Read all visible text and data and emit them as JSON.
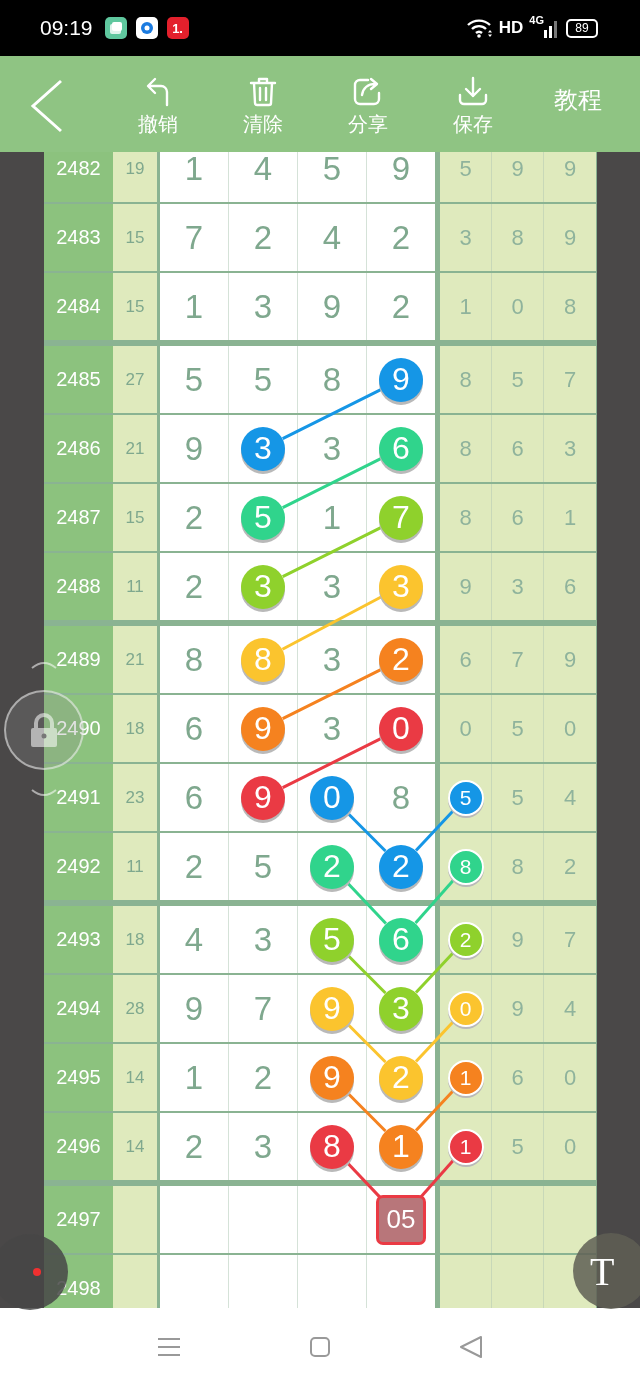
{
  "status_bar": {
    "time": "09:19",
    "app_badge": "1.",
    "network": "HD",
    "cellular": "4G",
    "battery": "89"
  },
  "toolbar": {
    "items": [
      {
        "label": "撤销",
        "kind": "undo"
      },
      {
        "label": "清除",
        "kind": "clear"
      },
      {
        "label": "分享",
        "kind": "share"
      },
      {
        "label": "保存",
        "kind": "save"
      }
    ],
    "tutorial": "教程"
  },
  "chart": {
    "groups": [
      {
        "rows": [
          {
            "period": "2482",
            "sum": "19",
            "cells": [
              {
                "kind": "digit",
                "text": "1"
              },
              {
                "kind": "digit",
                "text": "4"
              },
              {
                "kind": "digit",
                "text": "5"
              },
              {
                "kind": "digit",
                "text": "9"
              },
              {
                "kind": "digit",
                "text": "5"
              },
              {
                "kind": "digit",
                "text": "9"
              },
              {
                "kind": "digit",
                "text": "9"
              }
            ]
          },
          {
            "period": "2483",
            "sum": "15",
            "cells": [
              {
                "kind": "digit",
                "text": "7"
              },
              {
                "kind": "digit",
                "text": "2"
              },
              {
                "kind": "digit",
                "text": "4"
              },
              {
                "kind": "digit",
                "text": "2"
              },
              {
                "kind": "digit",
                "text": "3"
              },
              {
                "kind": "digit",
                "text": "8"
              },
              {
                "kind": "digit",
                "text": "9"
              }
            ]
          },
          {
            "period": "2484",
            "sum": "15",
            "cells": [
              {
                "kind": "digit",
                "text": "1"
              },
              {
                "kind": "digit",
                "text": "3"
              },
              {
                "kind": "digit",
                "text": "9"
              },
              {
                "kind": "digit",
                "text": "2"
              },
              {
                "kind": "digit",
                "text": "1"
              },
              {
                "kind": "digit",
                "text": "0"
              },
              {
                "kind": "digit",
                "text": "8"
              }
            ]
          }
        ]
      },
      {
        "rows": [
          {
            "period": "2485",
            "sum": "27",
            "cells": [
              {
                "kind": "digit",
                "text": "5"
              },
              {
                "kind": "digit",
                "text": "5"
              },
              {
                "kind": "digit",
                "text": "8"
              },
              {
                "kind": "ball",
                "text": "9",
                "color": "#1596e6"
              },
              {
                "kind": "digit",
                "text": "8"
              },
              {
                "kind": "digit",
                "text": "5"
              },
              {
                "kind": "digit",
                "text": "7"
              }
            ]
          },
          {
            "period": "2486",
            "sum": "21",
            "cells": [
              {
                "kind": "digit",
                "text": "9"
              },
              {
                "kind": "ball",
                "text": "3",
                "color": "#1596e6"
              },
              {
                "kind": "digit",
                "text": "3"
              },
              {
                "kind": "ball",
                "text": "6",
                "color": "#30d48c"
              },
              {
                "kind": "digit",
                "text": "8"
              },
              {
                "kind": "digit",
                "text": "6"
              },
              {
                "kind": "digit",
                "text": "3"
              }
            ]
          },
          {
            "period": "2487",
            "sum": "15",
            "cells": [
              {
                "kind": "digit",
                "text": "2"
              },
              {
                "kind": "ball",
                "text": "5",
                "color": "#30d48c"
              },
              {
                "kind": "digit",
                "text": "1"
              },
              {
                "kind": "ball",
                "text": "7",
                "color": "#8fd12c"
              },
              {
                "kind": "digit",
                "text": "8"
              },
              {
                "kind": "digit",
                "text": "6"
              },
              {
                "kind": "digit",
                "text": "1"
              }
            ]
          },
          {
            "period": "2488",
            "sum": "11",
            "cells": [
              {
                "kind": "digit",
                "text": "2"
              },
              {
                "kind": "ball",
                "text": "3",
                "color": "#8fd12c"
              },
              {
                "kind": "digit",
                "text": "3"
              },
              {
                "kind": "ball",
                "text": "3",
                "color": "#fbc42e"
              },
              {
                "kind": "digit",
                "text": "9"
              },
              {
                "kind": "digit",
                "text": "3"
              },
              {
                "kind": "digit",
                "text": "6"
              }
            ]
          }
        ]
      },
      {
        "rows": [
          {
            "period": "2489",
            "sum": "21",
            "cells": [
              {
                "kind": "digit",
                "text": "8"
              },
              {
                "kind": "ball",
                "text": "8",
                "color": "#fbc42e"
              },
              {
                "kind": "digit",
                "text": "3"
              },
              {
                "kind": "ball",
                "text": "2",
                "color": "#f5821f"
              },
              {
                "kind": "digit",
                "text": "6"
              },
              {
                "kind": "digit",
                "text": "7"
              },
              {
                "kind": "digit",
                "text": "9"
              }
            ]
          },
          {
            "period": "2490",
            "sum": "18",
            "cells": [
              {
                "kind": "digit",
                "text": "6"
              },
              {
                "kind": "ball",
                "text": "9",
                "color": "#f5821f"
              },
              {
                "kind": "digit",
                "text": "3"
              },
              {
                "kind": "ball",
                "text": "0",
                "color": "#ea3a44"
              },
              {
                "kind": "digit",
                "text": "0"
              },
              {
                "kind": "digit",
                "text": "5"
              },
              {
                "kind": "digit",
                "text": "0"
              }
            ]
          },
          {
            "period": "2491",
            "sum": "23",
            "cells": [
              {
                "kind": "digit",
                "text": "6"
              },
              {
                "kind": "ball",
                "text": "9",
                "color": "#ea3a44"
              },
              {
                "kind": "ball",
                "text": "0",
                "color": "#1596e6"
              },
              {
                "kind": "digit",
                "text": "8"
              },
              {
                "kind": "ball",
                "text": "5",
                "color": "#1596e6"
              },
              {
                "kind": "digit",
                "text": "5"
              },
              {
                "kind": "digit",
                "text": "4"
              }
            ]
          },
          {
            "period": "2492",
            "sum": "11",
            "cells": [
              {
                "kind": "digit",
                "text": "2"
              },
              {
                "kind": "digit",
                "text": "5"
              },
              {
                "kind": "ball",
                "text": "2",
                "color": "#30d48c"
              },
              {
                "kind": "ball",
                "text": "2",
                "color": "#1596e6"
              },
              {
                "kind": "ball",
                "text": "8",
                "color": "#30d48c"
              },
              {
                "kind": "digit",
                "text": "8"
              },
              {
                "kind": "digit",
                "text": "2"
              }
            ]
          }
        ]
      },
      {
        "rows": [
          {
            "period": "2493",
            "sum": "18",
            "cells": [
              {
                "kind": "digit",
                "text": "4"
              },
              {
                "kind": "digit",
                "text": "3"
              },
              {
                "kind": "ball",
                "text": "5",
                "color": "#8fd12c"
              },
              {
                "kind": "ball",
                "text": "6",
                "color": "#30d48c"
              },
              {
                "kind": "ball",
                "text": "2",
                "color": "#8fd12c"
              },
              {
                "kind": "digit",
                "text": "9"
              },
              {
                "kind": "digit",
                "text": "7"
              }
            ]
          },
          {
            "period": "2494",
            "sum": "28",
            "cells": [
              {
                "kind": "digit",
                "text": "9"
              },
              {
                "kind": "digit",
                "text": "7"
              },
              {
                "kind": "ball",
                "text": "9",
                "color": "#fbc42e"
              },
              {
                "kind": "ball",
                "text": "3",
                "color": "#8fd12c"
              },
              {
                "kind": "ball",
                "text": "0",
                "color": "#fbc42e"
              },
              {
                "kind": "digit",
                "text": "9"
              },
              {
                "kind": "digit",
                "text": "4"
              }
            ]
          },
          {
            "period": "2495",
            "sum": "14",
            "cells": [
              {
                "kind": "digit",
                "text": "1"
              },
              {
                "kind": "digit",
                "text": "2"
              },
              {
                "kind": "ball",
                "text": "9",
                "color": "#f5821f"
              },
              {
                "kind": "ball",
                "text": "2",
                "color": "#fbc42e"
              },
              {
                "kind": "ball",
                "text": "1",
                "color": "#f5821f"
              },
              {
                "kind": "digit",
                "text": "6"
              },
              {
                "kind": "digit",
                "text": "0"
              }
            ]
          },
          {
            "period": "2496",
            "sum": "14",
            "cells": [
              {
                "kind": "digit",
                "text": "2"
              },
              {
                "kind": "digit",
                "text": "3"
              },
              {
                "kind": "ball",
                "text": "8",
                "color": "#ea3a44"
              },
              {
                "kind": "ball",
                "text": "1",
                "color": "#f5821f"
              },
              {
                "kind": "ball",
                "text": "1",
                "color": "#ea3a44"
              },
              {
                "kind": "digit",
                "text": "5"
              },
              {
                "kind": "digit",
                "text": "0"
              }
            ]
          }
        ]
      },
      {
        "rows": [
          {
            "period": "2497",
            "cells": [
              {
                "kind": "empty"
              },
              {
                "kind": "empty"
              },
              {
                "kind": "empty"
              },
              {
                "kind": "box",
                "text": "05",
                "color": "#ea3a44"
              },
              {
                "kind": "empty"
              },
              {
                "kind": "empty"
              },
              {
                "kind": "empty"
              }
            ]
          },
          {
            "period": "2498",
            "cells": [
              {
                "kind": "empty"
              },
              {
                "kind": "empty"
              },
              {
                "kind": "empty"
              },
              {
                "kind": "empty"
              },
              {
                "kind": "empty"
              },
              {
                "kind": "empty"
              },
              {
                "kind": "empty"
              }
            ]
          }
        ]
      }
    ]
  },
  "floating": {
    "text_tool": "T"
  }
}
